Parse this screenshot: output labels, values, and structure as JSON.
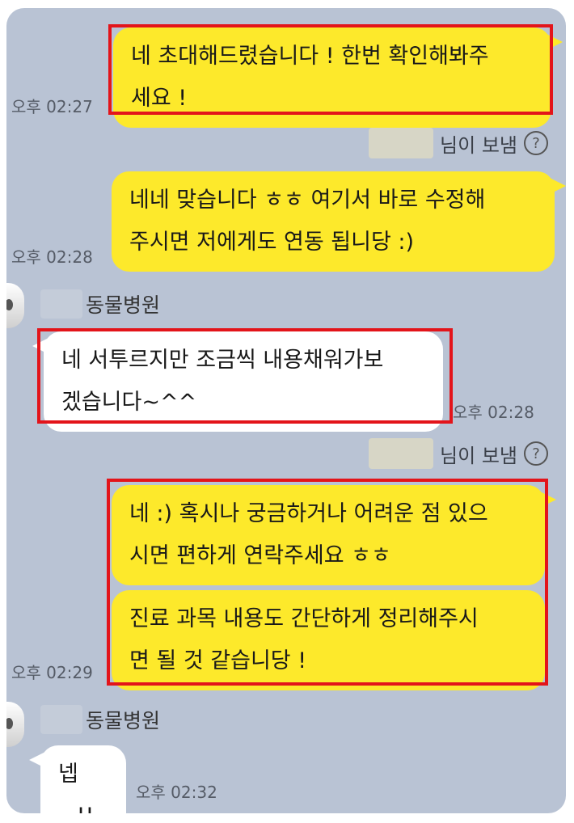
{
  "messages": {
    "m1": {
      "lines": [
        "네 초대해드렸습니다 ! 한번 확인해봐주",
        "세요 !"
      ],
      "time": "오후 02:27"
    },
    "m2": {
      "sender_suffix": "님이 보냄",
      "lines": [
        "네네 맞습니다 ㅎㅎ 여기서 바로 수정해",
        "주시면 저에게도 연동 됩니당 :)"
      ],
      "time": "오후 02:28"
    },
    "m3": {
      "sender_name": "동물병원",
      "lines": [
        "네 서투르지만 조금씩 내용채워가보",
        "겠습니다~^^"
      ],
      "time": "오후 02:28"
    },
    "m4": {
      "sender_suffix": "님이 보냄",
      "lines": [
        "네 :) 혹시나 궁금하거나 어려운 점 있으",
        "시면 편하게 연락주세요 ㅎㅎ"
      ]
    },
    "m5": {
      "lines": [
        "진료 과목 내용도 간단하게 정리해주시",
        "면 될 것 같습니당 !"
      ],
      "time": "오후 02:29"
    },
    "m6": {
      "sender_name": "동물병원",
      "text": "넵~!!",
      "time": "오후 02:32"
    }
  },
  "icons": {
    "help": "question-circle-icon"
  },
  "colors": {
    "background": "#b9c3d4",
    "my_bubble": "#fde92b",
    "their_bubble": "#ffffff",
    "highlight": "#e3141a"
  }
}
